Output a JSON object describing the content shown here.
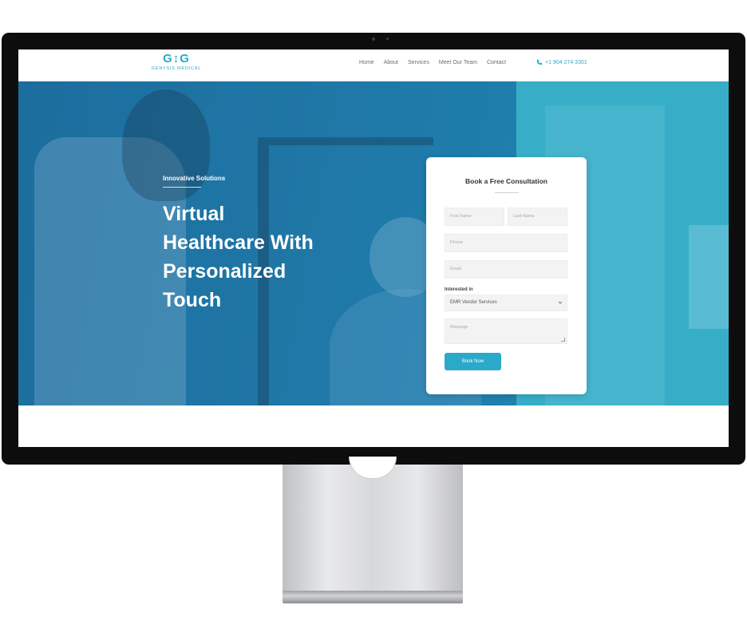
{
  "brand": {
    "logo_mark": "G↕G",
    "logo_text": "GENYSIS MEDICAL",
    "accent_color": "#2aa9c9"
  },
  "nav": {
    "items": [
      "Home",
      "About",
      "Services",
      "Meet Our Team",
      "Contact"
    ],
    "phone": "+1 904 274 3301",
    "phone_icon": "phone-icon"
  },
  "hero": {
    "eyebrow": "Innovative Solutions",
    "title_lines": [
      "Virtual",
      "Healthcare With",
      "Personalized",
      "Touch"
    ]
  },
  "form": {
    "title": "Book a Free Consultation",
    "first_name_placeholder": "First Name",
    "last_name_placeholder": "Last Name",
    "phone_placeholder": "Phone",
    "email_placeholder": "Email",
    "interested_label": "Interested in",
    "interested_value": "EMR Vendor Services",
    "message_placeholder": "Message",
    "submit_label": "Book Now"
  }
}
